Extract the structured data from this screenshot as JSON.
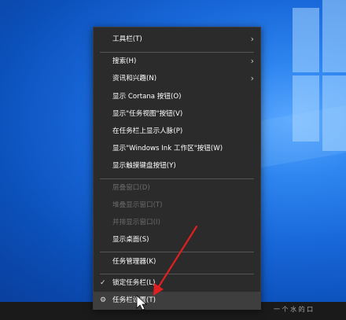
{
  "menu": {
    "toolbars": "工具栏(T)",
    "search": "搜索(H)",
    "news_interests": "资讯和兴趣(N)",
    "show_cortana": "显示 Cortana 按钮(O)",
    "show_task_view": "显示\"任务视图\"按钮(V)",
    "show_people": "在任务栏上显示人脉(P)",
    "show_ink": "显示\"Windows Ink 工作区\"按钮(W)",
    "show_keyboard": "显示触摸键盘按钮(Y)",
    "cascade": "层叠窗口(D)",
    "stack": "堆叠显示窗口(T)",
    "side_by_side": "并排显示窗口(I)",
    "show_desktop": "显示桌面(S)",
    "task_manager": "任务管理器(K)",
    "lock_taskbar": "锁定任务栏(L)",
    "taskbar_settings": "任务栏设置(T)"
  },
  "icons": {
    "submenu": "chevron-right-icon",
    "check": "checkmark-icon",
    "settings": "gear-icon",
    "cursor": "mouse-pointer-icon",
    "annotation": "red-arrow-icon"
  },
  "colors": {
    "menu_bg": "#2b2b2b",
    "hover_bg": "#3e3e3e",
    "annotation": "#e02020",
    "desktop": "#1867d9"
  },
  "watermark": "一 个 水 的 口"
}
